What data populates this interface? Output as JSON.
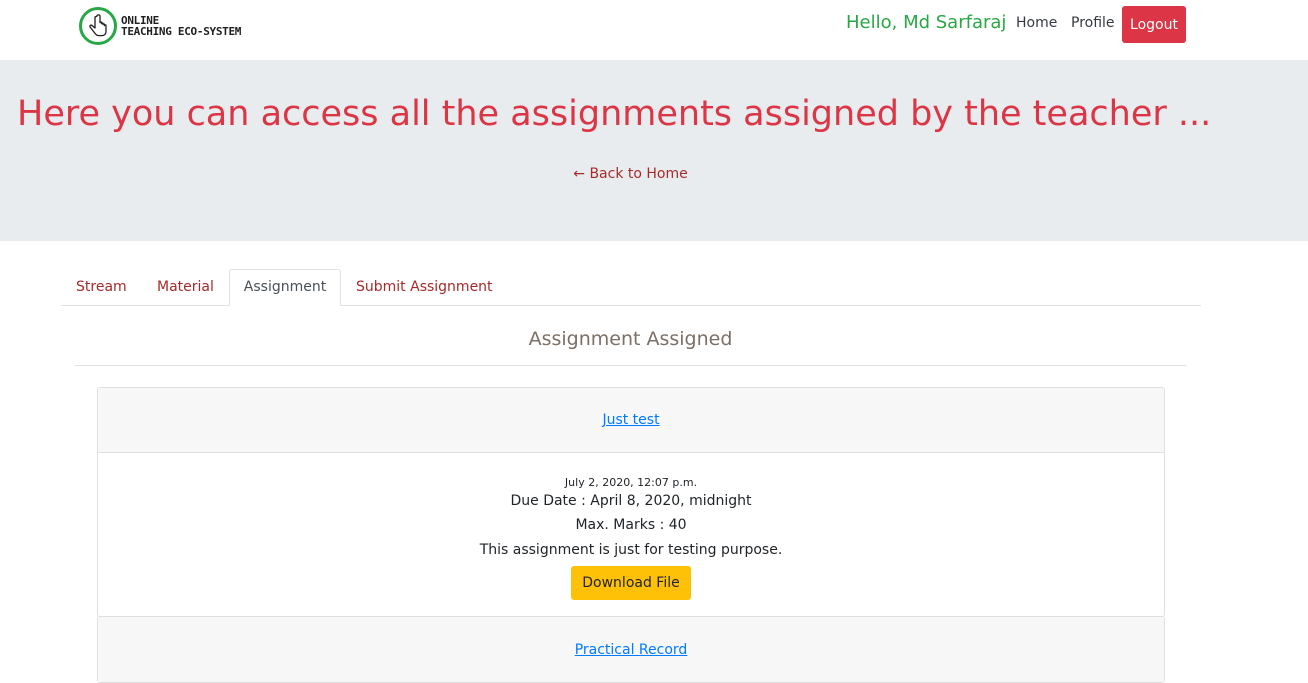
{
  "brand": {
    "line1": "ONLINE",
    "line2": "TEACHING ECO-SYSTEM",
    "icon": "pointer-hand-icon",
    "icon_ring_color": "#28a745"
  },
  "header": {
    "greeting": "Hello, Md Sarfaraj",
    "nav": {
      "home": "Home",
      "profile": "Profile",
      "logout": "Logout"
    }
  },
  "hero": {
    "title": "Here you can access all the assignments assigned by the teacher ...",
    "back_link": "← Back to Home"
  },
  "tabs": [
    {
      "label": "Stream",
      "active": false
    },
    {
      "label": "Material",
      "active": false
    },
    {
      "label": "Assignment",
      "active": true
    },
    {
      "label": "Submit Assignment",
      "active": false
    }
  ],
  "section": {
    "title": "Assignment Assigned"
  },
  "assignments": [
    {
      "title": "Just test",
      "posted": "July 2, 2020, 12:07 p.m.",
      "due": "Due Date : April 8, 2020, midnight",
      "max_marks": "Max. Marks : 40",
      "description": "This assignment is just for testing purpose.",
      "download_label": "Download File"
    },
    {
      "title": "Practical Record"
    }
  ],
  "colors": {
    "success": "#28a745",
    "danger": "#dc3545",
    "warning": "#ffc107",
    "link": "#007bff",
    "jumbotron_bg": "#e9ecef"
  }
}
